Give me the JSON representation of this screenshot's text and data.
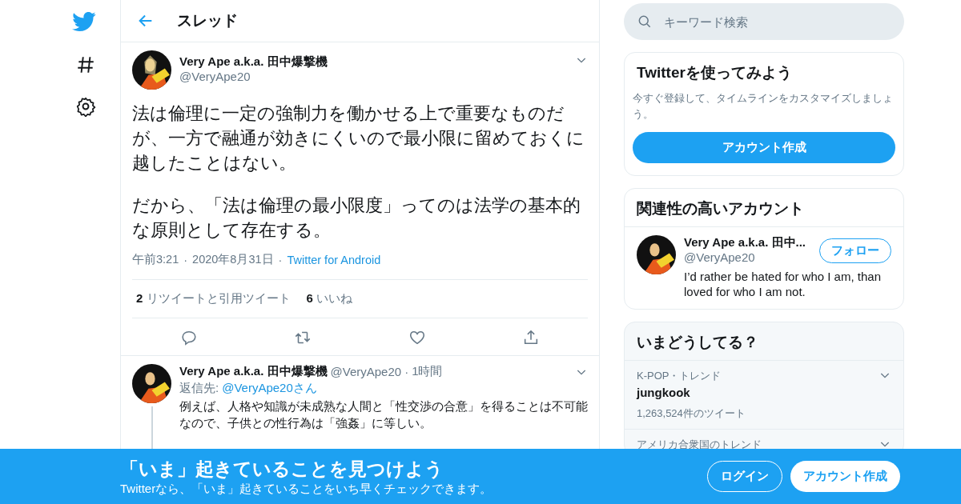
{
  "header": {
    "title": "スレッド"
  },
  "main_tweet": {
    "name": "Very Ape a.k.a. 田中爆撃機",
    "handle": "@VeryApe20",
    "paragraphs": [
      "法は倫理に一定の強制力を働かせる上で重要なものだが、一方で融通が効きにくいので最小限に留めておくに越したことはない。",
      "だから、「法は倫理の最小限度」ってのは法学の基本的な原則として存在する。"
    ],
    "time": "午前3:21",
    "separator": "·",
    "date": "2020年8月31日",
    "source": "Twitter for Android",
    "stats": [
      {
        "count": "2",
        "label": "リツイートと引用ツイート"
      },
      {
        "count": "6",
        "label": "いいね"
      }
    ]
  },
  "reply": {
    "name": "Very Ape a.k.a. 田中爆撃機",
    "handle": "@VeryApe20",
    "separator": "·",
    "time": "1時間",
    "reply_to_label": "返信先:",
    "reply_to_handle": "@VeryApe20さん",
    "text": "例えば、人格や知識が未成熟な人間と「性交渉の合意」を得ることは不可能なので、子供との性行為は「強姦」に等しい。"
  },
  "search": {
    "placeholder": "キーワード検索"
  },
  "signup_card": {
    "title": "Twitterを使ってみよう",
    "text": "今すぐ登録して、タイムラインをカスタマイズしましょう。",
    "button": "アカウント作成"
  },
  "related_card": {
    "title": "関連性の高いアカウント",
    "name": "Very Ape a.k.a. 田中...",
    "handle": "@VeryApe20",
    "button": "フォロー",
    "bio": "I’d rather be hated for who I am, than loved for who I am not."
  },
  "trends_card": {
    "title": "いまどうしてる？",
    "items": [
      {
        "context": "K-POP・トレンド",
        "name": "jungkook",
        "count": "1,263,524件のツイート"
      },
      {
        "context": "アメリカ合衆国のトレンド"
      }
    ]
  },
  "banner": {
    "title": "「いま」起きていることを見つけよう",
    "subtitle": "Twitterなら、「いま」起きていることをいち早くチェックできます。",
    "login": "ログイン",
    "signup": "アカウント作成"
  }
}
